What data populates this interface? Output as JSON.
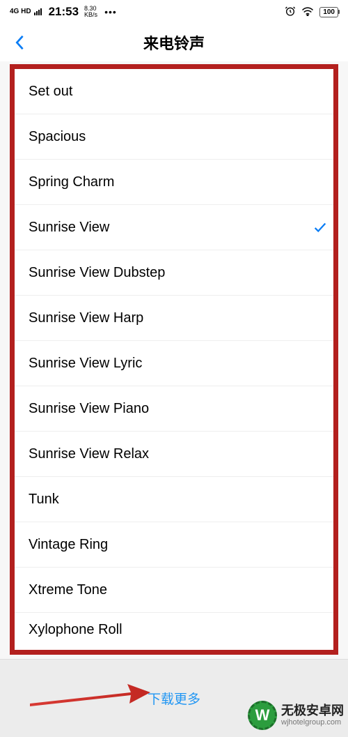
{
  "status": {
    "network_label": "4G HD",
    "time": "21:53",
    "speed_value": "8.30",
    "speed_unit": "KB/s",
    "dots": "•••",
    "battery": "100"
  },
  "nav": {
    "title": "来电铃声"
  },
  "ringtones": [
    {
      "name": "Set out",
      "selected": false
    },
    {
      "name": "Spacious",
      "selected": false
    },
    {
      "name": "Spring Charm",
      "selected": false
    },
    {
      "name": "Sunrise View",
      "selected": true
    },
    {
      "name": "Sunrise View Dubstep",
      "selected": false
    },
    {
      "name": "Sunrise View Harp",
      "selected": false
    },
    {
      "name": "Sunrise View Lyric",
      "selected": false
    },
    {
      "name": "Sunrise View Piano",
      "selected": false
    },
    {
      "name": "Sunrise View Relax",
      "selected": false
    },
    {
      "name": "Tunk",
      "selected": false
    },
    {
      "name": "Vintage Ring",
      "selected": false
    },
    {
      "name": "Xtreme Tone",
      "selected": false
    },
    {
      "name": "Xylophone Roll",
      "selected": false
    }
  ],
  "footer": {
    "download_label": "下载更多"
  },
  "brand": {
    "logo_letter": "W",
    "main": "无极安卓网",
    "sub": "wjhotelgroup.com"
  }
}
